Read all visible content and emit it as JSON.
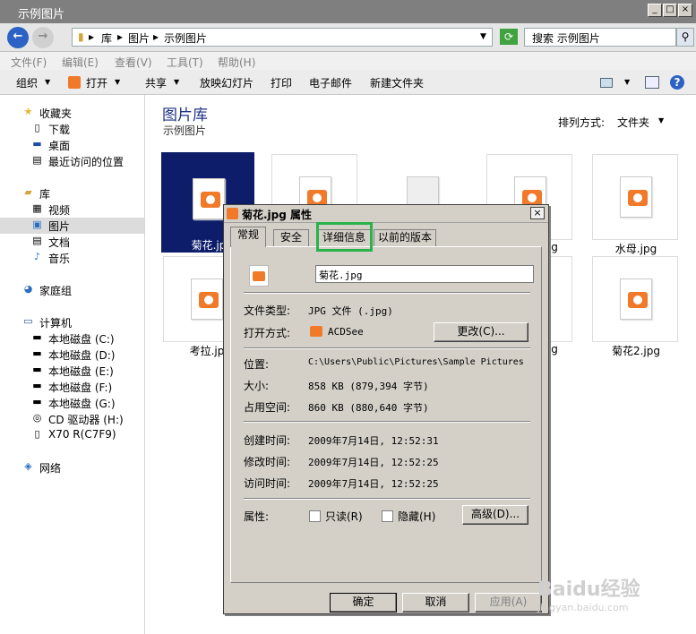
{
  "window": {
    "title": "示例图片"
  },
  "address": {
    "crumbs": [
      "库",
      "图片",
      "示例图片"
    ],
    "search_placeholder": "搜索 示例图片"
  },
  "menu": [
    "文件(F)",
    "编辑(E)",
    "查看(V)",
    "工具(T)",
    "帮助(H)"
  ],
  "toolbar": {
    "organize": "组织",
    "open": "打开",
    "share": "共享",
    "slideshow": "放映幻灯片",
    "print": "打印",
    "email": "电子邮件",
    "new_folder": "新建文件夹"
  },
  "sidebar": {
    "favorites": "收藏夹",
    "downloads": "下载",
    "desktop": "桌面",
    "recent": "最近访问的位置",
    "libraries": "库",
    "videos": "视频",
    "pictures": "图片",
    "documents": "文档",
    "music": "音乐",
    "homegroup": "家庭组",
    "computer": "计算机",
    "drives": [
      "本地磁盘 (C:)",
      "本地磁盘 (D:)",
      "本地磁盘 (E:)",
      "本地磁盘 (F:)",
      "本地磁盘 (G:)",
      "CD 驱动器 (H:)",
      "X70 R(C7F9)"
    ],
    "network": "网络"
  },
  "content": {
    "title": "图片库",
    "subtitle": "示例图片",
    "sort_label": "排列方式:",
    "sort_value": "文件夹",
    "thumbs": [
      "菊花.jpg",
      "",
      "",
      "",
      "水母.jpg",
      "考拉.jpg",
      "",
      "",
      "",
      "菊花2.jpg"
    ],
    "labels_visible": {
      "t0": "菊花.jp",
      "t4": "水母.jpg",
      "t5": "考拉.jp",
      "t9": "菊花2.jpg",
      "partial1": "g",
      "partial2": "g"
    }
  },
  "dialog": {
    "title": "菊花.jpg 属性",
    "tabs": [
      "常规",
      "安全",
      "详细信息",
      "以前的版本"
    ],
    "filename": "菊花.jpg",
    "type_label": "文件类型:",
    "type_value": "JPG 文件 (.jpg)",
    "open_label": "打开方式:",
    "open_value": "ACDSee",
    "change_btn": "更改(C)...",
    "location_label": "位置:",
    "location_value": "C:\\Users\\Public\\Pictures\\Sample Pictures",
    "size_label": "大小:",
    "size_value": "858 KB (879,394 字节)",
    "disk_label": "占用空间:",
    "disk_value": "860 KB (880,640 字节)",
    "created_label": "创建时间:",
    "created_value": "2009年7月14日, 12:52:31",
    "modified_label": "修改时间:",
    "modified_value": "2009年7月14日, 12:52:25",
    "accessed_label": "访问时间:",
    "accessed_value": "2009年7月14日, 12:52:25",
    "attr_label": "属性:",
    "readonly": "只读(R)",
    "hidden": "隐藏(H)",
    "advanced_btn": "高级(D)...",
    "ok": "确定",
    "cancel": "取消",
    "apply": "应用(A)"
  },
  "watermark": {
    "main": "Baidu经验",
    "sub": "jingyan.baidu.com"
  }
}
